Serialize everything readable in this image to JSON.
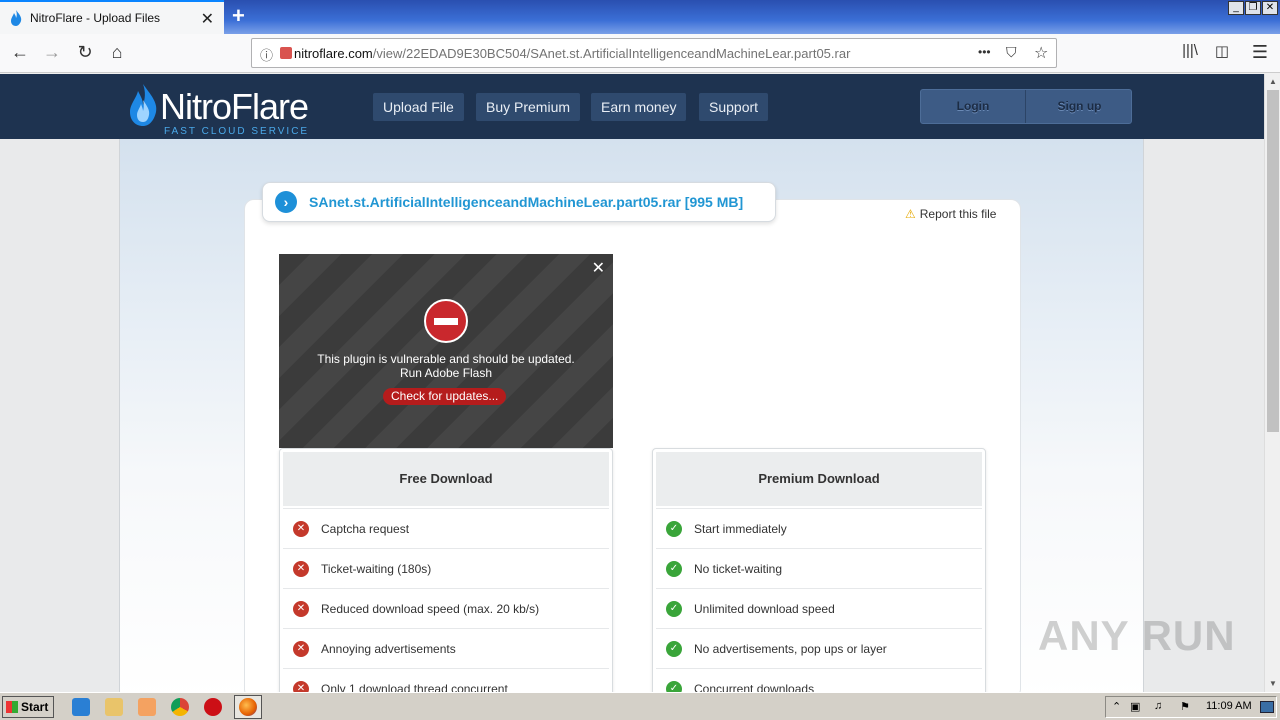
{
  "browser": {
    "tab_title": "NitroFlare - Upload Files",
    "tab_close": "✕",
    "new_tab": "+",
    "url_host": "nitroflare.com",
    "url_path": "/view/22EDAD9E30BC504/SAnet.st.ArtificialIntelligenceandMachineLear.part05.rar",
    "url_more": "•••",
    "window_controls": [
      "_",
      "❐",
      "✕"
    ]
  },
  "site": {
    "logo_name": "NitroFlare",
    "logo_tagline": "FAST CLOUD SERVICE",
    "nav": [
      "Upload File",
      "Buy Premium",
      "Earn money",
      "Support"
    ],
    "login": "Login",
    "signup": "Sign up"
  },
  "file": {
    "name": "SAnet.st.ArtificialIntelligenceandMachineLear.part05.rar [995 MB]",
    "report": "Report this file"
  },
  "flash": {
    "close": "✕",
    "message_line1": "This plugin is vulnerable and should be updated.",
    "message_line2": "Run Adobe Flash",
    "update_button": "Check for updates..."
  },
  "free": {
    "title": "Free Download",
    "items": [
      "Captcha request",
      "Ticket-waiting (180s)",
      "Reduced download speed (max. 20 kb/s)",
      "Annoying advertisements",
      "Only 1 download thread concurrent"
    ]
  },
  "premium": {
    "title": "Premium Download",
    "items": [
      "Start immediately",
      "No ticket-waiting",
      "Unlimited download speed",
      "No advertisements, pop ups or layer",
      "Concurrent downloads"
    ]
  },
  "watermark": "ANY RUN",
  "taskbar": {
    "start": "Start",
    "clock": "11:09 AM"
  },
  "colors": {
    "header_bg": "#1e3350",
    "filename_blue": "#2196d3",
    "bad_icon": "#c4392b",
    "good_icon": "#3aa53a"
  }
}
